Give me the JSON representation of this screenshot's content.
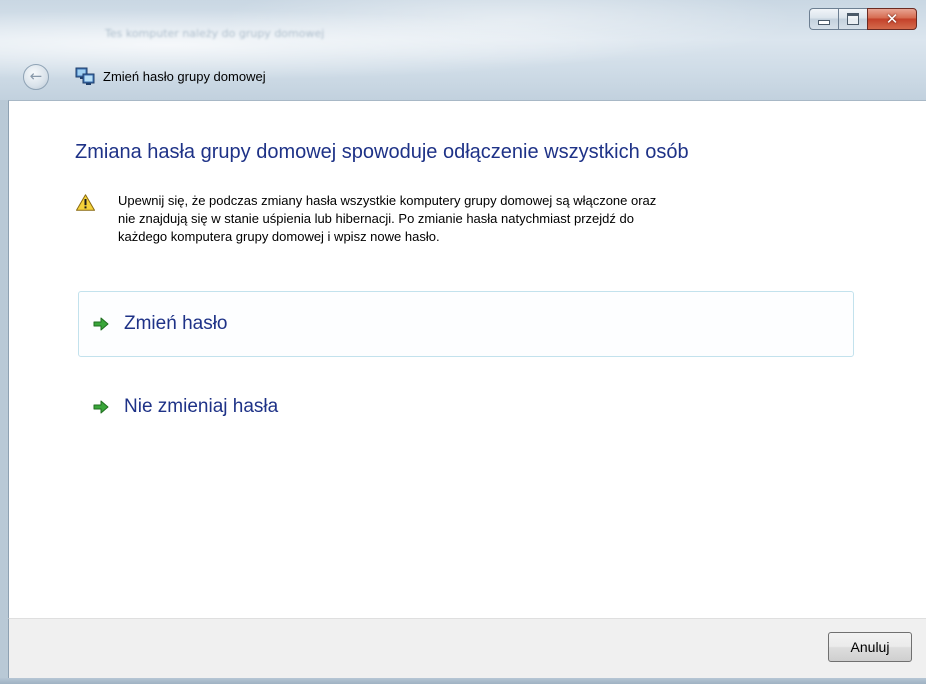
{
  "window": {
    "title": "Zmień hasło grupy domowej",
    "ghost_title": "Tes komputer należy do grupy domowej"
  },
  "icons": {
    "back": "back-arrow-icon",
    "title": "homegroup-icon",
    "minimize": "minimize-icon",
    "maximize": "maximize-icon",
    "close": "close-icon",
    "warning": "warning-icon",
    "option_arrow": "green-arrow-icon"
  },
  "main": {
    "heading": "Zmiana hasła grupy domowej spowoduje odłączenie wszystkich osób",
    "warning_lines": [
      "Upewnij się, że podczas zmiany hasła wszystkie komputery grupy domowej są włączone oraz",
      "nie znajdują się w stanie uśpienia lub hibernacji. Po zmianie hasła natychmiast przejdź do",
      "każdego komputera grupy domowej i wpisz nowe hasło."
    ],
    "options": [
      {
        "label": "Zmień hasło"
      },
      {
        "label": "Nie zmieniaj hasła"
      }
    ]
  },
  "footer": {
    "cancel_label": "Anuluj"
  },
  "colors": {
    "heading": "#1e3287",
    "option_text": "#1e3287",
    "arrow_green": "#3aa63a",
    "warning_yellow": "#f4d23a",
    "close_red": "#c4412a"
  }
}
